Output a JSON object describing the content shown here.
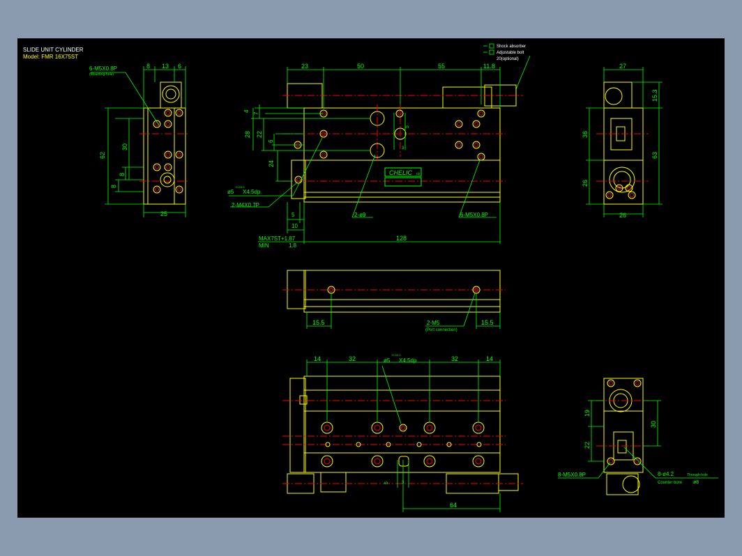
{
  "title": {
    "line1": "SLIDE UNIT CYLINDER",
    "line2": "Model: FMR 16X75ST"
  },
  "colors": {
    "background": "#8a9bb0",
    "drawing_bg": "#000000",
    "part": "#ffff00",
    "dim": "#00ff00",
    "centerline": "#ff0000",
    "text": "#ffffff"
  },
  "legend": {
    "shock": "Shock absorber",
    "bolt": "Adjustable bolt",
    "optional": "20(optional)"
  },
  "left_view": {
    "top_dims": [
      "8",
      "13",
      "6"
    ],
    "hole_label": "6-M5X0.8P",
    "hole_sub": "(Mounting-hole)",
    "side_dims": [
      "62",
      "30",
      "8",
      "8"
    ],
    "bottom_dim": "25"
  },
  "front_view": {
    "top_dims": [
      "23",
      "50",
      "55",
      "11.8"
    ],
    "left_dims": [
      "4",
      "7",
      "28",
      "22",
      "6",
      "24"
    ],
    "dia_note": "ø5",
    "dia_tol": "+0.03 0",
    "dia_depth": "X4.5dp",
    "tap": "2-M4X0.7P",
    "bottom_dims": [
      "5",
      "10"
    ],
    "max_label": "MAX7ST+1.87",
    "min_label": "MIN",
    "min_value": "1.8",
    "length": "128",
    "holes": "2-ø9",
    "mount": "6-M5X0.8P",
    "brand": "CHELIC",
    "brand_sub": "ck",
    "small_dims": [
      "5",
      "3"
    ]
  },
  "right_view": {
    "top_dims": [
      "27"
    ],
    "side_right": [
      "15.3",
      "63"
    ],
    "side_left": [
      "36",
      "26"
    ],
    "bottom_dim": "26"
  },
  "mid_view": {
    "dims": [
      "15.5",
      "15.5"
    ],
    "port": "2-M5",
    "port_sub": "(Port connection)"
  },
  "bottom_view": {
    "top_dims": [
      "14",
      "32",
      "32",
      "14"
    ],
    "dia_note": "ø5",
    "dia_tol": "+0.03 0",
    "dia_depth": "X4.5dp",
    "small_dims": [
      "5",
      "3"
    ],
    "length": "64"
  },
  "end_view": {
    "dims": [
      "19",
      "22",
      "30"
    ],
    "tap": "8-M5X0.8P",
    "thru": "8-ø4.2",
    "thru_sub": "Through-hole",
    "cbore": "Counter bore",
    "cbore_val": "ø8"
  }
}
